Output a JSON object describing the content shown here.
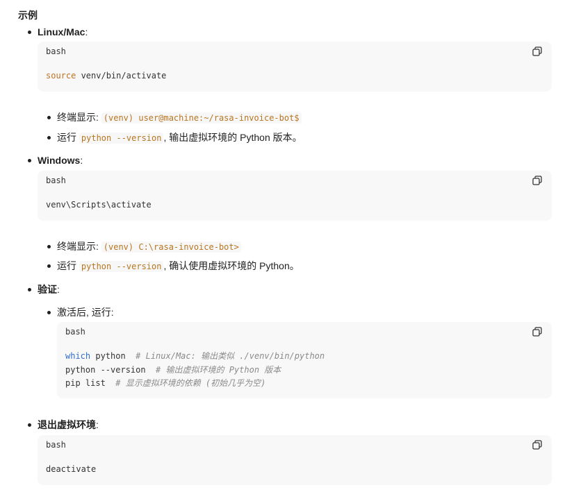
{
  "heading": "示例",
  "sections": {
    "linux": {
      "label": "Linux/Mac",
      "colon": ":",
      "code": {
        "lang": "bash",
        "keyword": "source",
        "rest": " venv/bin/activate"
      },
      "sub1": {
        "prefix": "终端显示:",
        "code": "(venv) user@machine:~/rasa-invoice-bot$"
      },
      "sub2": {
        "prefix": "运行",
        "code": "python --version",
        "suffix": ", 输出虚拟环境的 Python 版本。"
      }
    },
    "windows": {
      "label": "Windows",
      "colon": ":",
      "code": {
        "lang": "bash",
        "line": "venv\\Scripts\\activate"
      },
      "sub1": {
        "prefix": "终端显示:",
        "code": "(venv) C:\\rasa-invoice-bot>"
      },
      "sub2": {
        "prefix": "运行",
        "code": "python --version",
        "suffix": ", 确认使用虚拟环境的 Python。"
      }
    },
    "verify": {
      "label": "验证",
      "colon": ":",
      "sub": "激活后, 运行:",
      "code": {
        "lang": "bash",
        "line1_kw": "which",
        "line1_cmd": " python",
        "line1_cmt": "  # Linux/Mac: 输出类似 ./venv/bin/python",
        "line2_cmd": "python --version",
        "line2_cmt": "  # 输出虚拟环境的 Python 版本",
        "line3_cmd": "pip list",
        "line3_cmt": "  # 显示虚拟环境的依赖 (初始几乎为空)"
      }
    },
    "exit": {
      "label": "退出虚拟环境",
      "colon": ":",
      "code": {
        "lang": "bash",
        "line": "deactivate"
      }
    }
  },
  "icons": {
    "copy": "copy-icon"
  },
  "colors": {
    "code_bg": "#f8f8f8",
    "inline_code_text": "#b8751f",
    "keyword_orange": "#c0721f",
    "keyword_blue": "#2f6fcf",
    "comment": "#8a8a8a"
  }
}
